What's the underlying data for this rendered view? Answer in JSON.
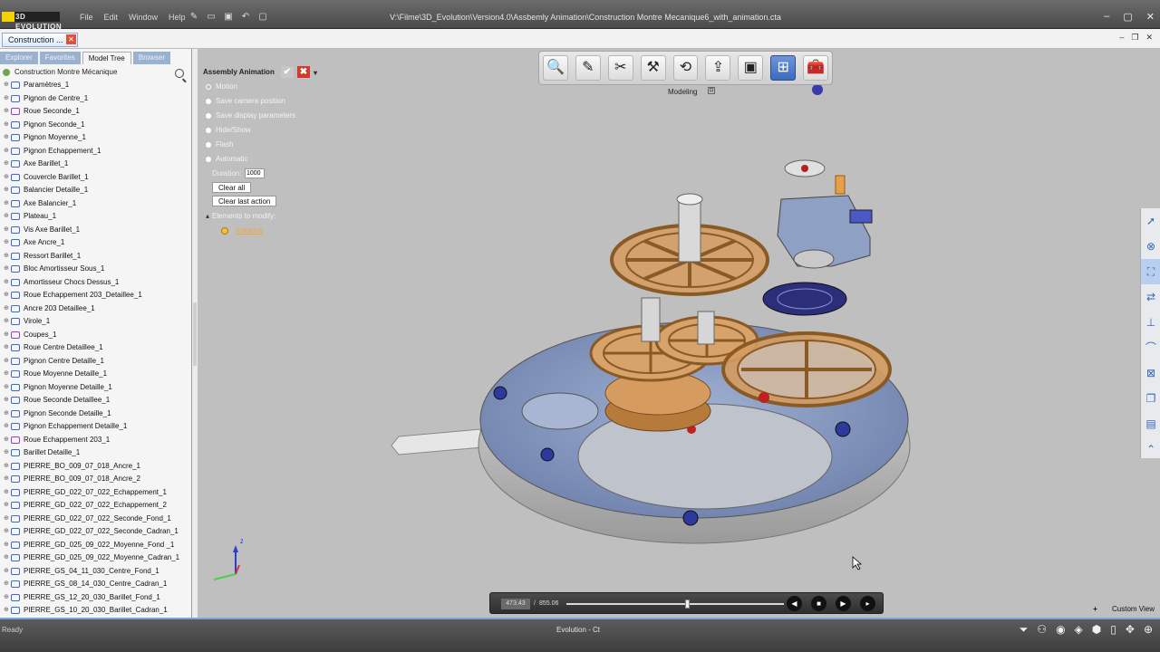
{
  "app": {
    "logo": "3D EVOLUTION",
    "menu": [
      "File",
      "Edit",
      "Window",
      "Help"
    ],
    "title": "V:\\Filme\\3D_Evolution\\Version4.0\\Assbemly Animation\\Construction Montre Mecanique6_with_animation.cta"
  },
  "doc_tab": {
    "label": "Construction ..."
  },
  "panel": {
    "tabs": [
      "Explorer",
      "Favorites",
      "Model Tree",
      "Browser"
    ],
    "active_tab": "Model Tree",
    "root": "Construction Montre Mécanique",
    "items": [
      {
        "label": "Paramètres_1",
        "icon": "blue"
      },
      {
        "label": "Pignon de Centre_1",
        "icon": "blue"
      },
      {
        "label": "Roue Seconde_1",
        "icon": "purple"
      },
      {
        "label": "Pignon Seconde_1",
        "icon": "blue"
      },
      {
        "label": "Pignon Moyenne_1",
        "icon": "blue"
      },
      {
        "label": "Pignon Echappement_1",
        "icon": "blue"
      },
      {
        "label": "Axe Barillet_1",
        "icon": "blue"
      },
      {
        "label": "Couvercle Barillet_1",
        "icon": "blue"
      },
      {
        "label": "Balancier Detaille_1",
        "icon": "blue"
      },
      {
        "label": "Axe Balancier_1",
        "icon": "blue"
      },
      {
        "label": "Plateau_1",
        "icon": "blue"
      },
      {
        "label": "Vis Axe Barillet_1",
        "icon": "blue"
      },
      {
        "label": "Axe Ancre_1",
        "icon": "blue"
      },
      {
        "label": "Ressort Barillet_1",
        "icon": "blue"
      },
      {
        "label": "Bloc Amortisseur Sous_1",
        "icon": "blue"
      },
      {
        "label": "Amortisseur Chocs Dessus_1",
        "icon": "blue"
      },
      {
        "label": "Roue Echappement 203_Detaillee_1",
        "icon": "blue"
      },
      {
        "label": "Ancre 203 Detaillee_1",
        "icon": "blue"
      },
      {
        "label": "Virole_1",
        "icon": "blue"
      },
      {
        "label": "Coupes_1",
        "icon": "purple"
      },
      {
        "label": "Roue Centre Detaillee_1",
        "icon": "blue"
      },
      {
        "label": "Pignon Centre Detaille_1",
        "icon": "blue"
      },
      {
        "label": "Roue Moyenne Detaille_1",
        "icon": "blue"
      },
      {
        "label": "Pignon Moyenne Detaille_1",
        "icon": "blue"
      },
      {
        "label": "Roue Seconde Detaillee_1",
        "icon": "blue"
      },
      {
        "label": "Pignon Seconde Detaille_1",
        "icon": "blue"
      },
      {
        "label": "Pignon Echappement Detaille_1",
        "icon": "blue"
      },
      {
        "label": "Roue Echappement 203_1",
        "icon": "purple"
      },
      {
        "label": "Barillet Detaille_1",
        "icon": "blue"
      },
      {
        "label": "PIERRE_BO_009_07_018_Ancre_1",
        "icon": "blue"
      },
      {
        "label": "PIERRE_BO_009_07_018_Ancre_2",
        "icon": "blue"
      },
      {
        "label": "PIERRE_GD_022_07_022_Echappement_1",
        "icon": "blue"
      },
      {
        "label": "PIERRE_GD_022_07_022_Echappement_2",
        "icon": "blue"
      },
      {
        "label": "PIERRE_GD_022_07_022_Seconde_Fond_1",
        "icon": "blue"
      },
      {
        "label": "PIERRE_GD_022_07_022_Seconde_Cadran_1",
        "icon": "blue"
      },
      {
        "label": "PIERRE_GD_025_09_022_Moyenne_Fond _1",
        "icon": "blue"
      },
      {
        "label": "PIERRE_GD_025_09_022_Moyenne_Cadran_1",
        "icon": "blue"
      },
      {
        "label": "PIERRE_GS_04_11_030_Centre_Fond_1",
        "icon": "blue"
      },
      {
        "label": "PIERRE_GS_08_14_030_Centre_Cadran_1",
        "icon": "blue"
      },
      {
        "label": "PIERRE_GS_12_20_030_Barillet_Fond_1",
        "icon": "blue"
      },
      {
        "label": "PIERRE_GS_10_20_030_Barillet_Cadran_1",
        "icon": "blue"
      }
    ]
  },
  "animation": {
    "title": "Assembly Animation",
    "options": [
      {
        "label": "Motion",
        "selected": false
      },
      {
        "label": "Save camera position",
        "selected": true
      },
      {
        "label": "Save display parameters",
        "selected": true
      },
      {
        "label": "Hide/Show",
        "selected": true
      },
      {
        "label": "Flash",
        "selected": true
      },
      {
        "label": "Automatic",
        "selected": true
      }
    ],
    "duration_label": "Duration:",
    "duration_value": "1000",
    "clear_all": "Clear all",
    "clear_last": "Clear last action",
    "elements_label": "Elements to modify:",
    "instance": "Instance"
  },
  "toolbar": {
    "label": "Modeling",
    "buttons": [
      {
        "name": "zoom-icon",
        "glyph": "🔍",
        "active": false
      },
      {
        "name": "sketch-edit-icon",
        "glyph": "✎",
        "active": false
      },
      {
        "name": "tools-icon",
        "glyph": "✂",
        "active": false
      },
      {
        "name": "dimension-icon",
        "glyph": "⚒",
        "active": false
      },
      {
        "name": "rotate-part-icon",
        "glyph": "⟲",
        "active": false
      },
      {
        "name": "export-icon",
        "glyph": "⇪",
        "active": false
      },
      {
        "name": "frame-icon",
        "glyph": "▣",
        "active": false
      },
      {
        "name": "assembly-icon",
        "glyph": "⊞",
        "active": true
      },
      {
        "name": "toolbox-icon",
        "glyph": "🧰",
        "active": false
      }
    ]
  },
  "playback": {
    "current": "473.43",
    "separator": "/",
    "total": "855.06",
    "progress": 0.553
  },
  "axes": {
    "z": "z"
  },
  "view": {
    "custom_view": "Custom View"
  },
  "status": {
    "left": "Ready",
    "center": "Evolution - Ct"
  },
  "colors": {
    "viewport": "#bfbfbf",
    "accent": "#3d6ac0",
    "gear": "#d59b5f",
    "plate": "#8ea0c4"
  }
}
